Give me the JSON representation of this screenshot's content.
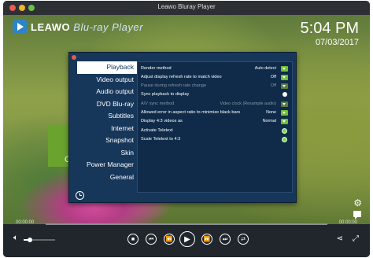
{
  "window": {
    "title": "Leawo Bluray Player"
  },
  "overlay": {
    "logo_brand": "LEAWO",
    "logo_product": "Blu-ray Player",
    "time": "5:04 PM",
    "date": "07/03/2017",
    "partial_letter": "C"
  },
  "sidebar": {
    "items": [
      {
        "label": "Playback",
        "active": true
      },
      {
        "label": "Video output",
        "active": false
      },
      {
        "label": "Audio output",
        "active": false
      },
      {
        "label": "DVD  Blu-ray",
        "active": false
      },
      {
        "label": "Subtitles",
        "active": false
      },
      {
        "label": "Internet",
        "active": false
      },
      {
        "label": "Snapshot",
        "active": false
      },
      {
        "label": "Skin",
        "active": false
      },
      {
        "label": "Power Manager",
        "active": false
      },
      {
        "label": "General",
        "active": false
      }
    ]
  },
  "settings": {
    "rows": [
      {
        "label": "Render method",
        "value": "Auto detect",
        "control": "dropdown",
        "disabled": false
      },
      {
        "label": "Adjust display refresh rate to match video",
        "value": "Off",
        "control": "dropdown",
        "disabled": false
      },
      {
        "label": "Pause during refresh rate change",
        "value": "Off",
        "control": "dropdown",
        "disabled": true
      },
      {
        "label": "Sync playback to display",
        "value": "",
        "control": "check-off",
        "disabled": false
      },
      {
        "label": "A/V sync method",
        "value": "Video clock (Resample audio)",
        "control": "dropdown",
        "disabled": true
      },
      {
        "label": "Allowed error in aspect ratio to minimize black bars",
        "value": "None",
        "control": "dropdown",
        "disabled": false
      },
      {
        "label": "Display 4:3 videos as",
        "value": "Normal",
        "control": "dropdown",
        "disabled": false
      },
      {
        "label": "Activate Teletext",
        "value": "",
        "control": "check-on",
        "disabled": false
      },
      {
        "label": "Scale Teletext to 4:3",
        "value": "",
        "control": "check-on",
        "disabled": false
      }
    ]
  },
  "player": {
    "elapsed": "00:00:00",
    "total": "00:00:00",
    "progress": 0,
    "volume": 0.2
  },
  "colors": {
    "dialog_bg": "#16365a",
    "accent_green": "#6fc02f",
    "controls_bg": "#20262c"
  },
  "icons": {
    "history": "history-icon",
    "gear": "gear-icon",
    "chat": "chat-icon",
    "volume": "volume-icon",
    "share": "share-icon",
    "resize": "resize-icon"
  }
}
